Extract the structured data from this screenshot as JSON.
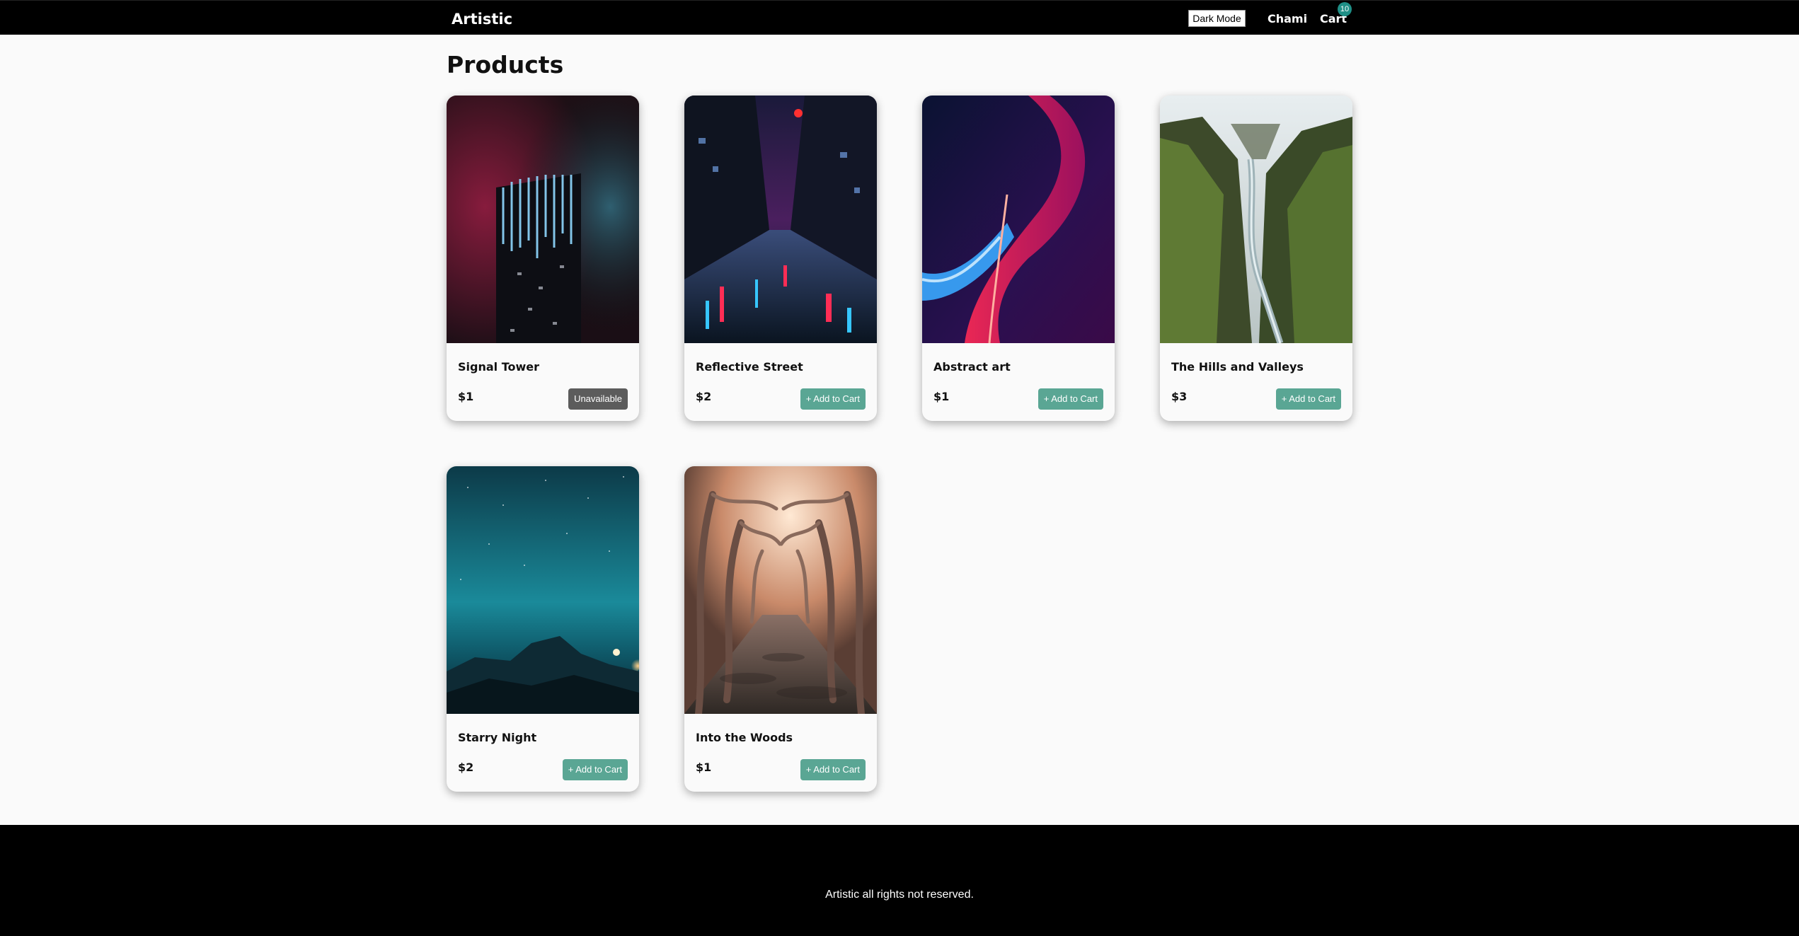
{
  "navbar": {
    "brand": "Artistic",
    "dark_mode_label": "Dark Mode",
    "user_name": "Chami",
    "cart_label": "Cart",
    "cart_count": "10"
  },
  "main": {
    "title": "Products",
    "products": [
      {
        "name": "Signal Tower",
        "price": "$1",
        "button": "Unavailable",
        "available": false
      },
      {
        "name": "Reflective Street",
        "price": "$2",
        "button": "+ Add to Cart",
        "available": true
      },
      {
        "name": "Abstract art",
        "price": "$1",
        "button": "+ Add to Cart",
        "available": true
      },
      {
        "name": "The Hills and Valleys",
        "price": "$3",
        "button": "+ Add to Cart",
        "available": true
      },
      {
        "name": "Starry Night",
        "price": "$2",
        "button": "+ Add to Cart",
        "available": true
      },
      {
        "name": "Into the Woods",
        "price": "$1",
        "button": "+ Add to Cart",
        "available": true
      }
    ]
  },
  "footer": {
    "text": "Artistic all rights not reserved."
  },
  "colors": {
    "navbar_bg": "#000000",
    "add_button": "#5aa694",
    "unavailable_button": "#5c5c5c",
    "badge": "#1f8f86"
  }
}
